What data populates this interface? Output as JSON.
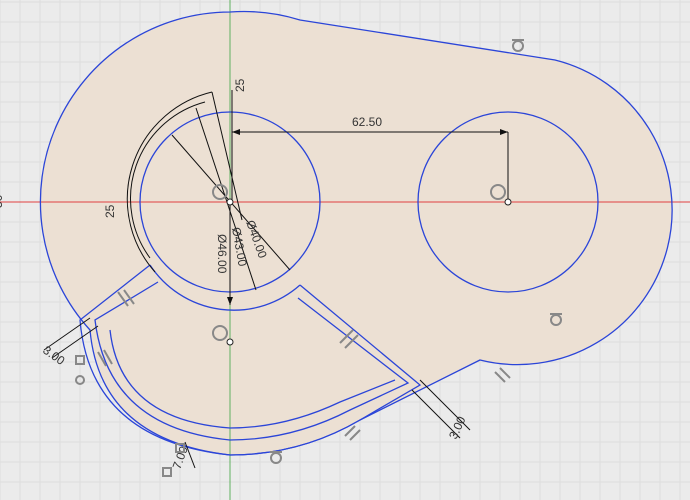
{
  "canvas": {
    "background": "#ebebeb",
    "profile_fill": "#ece0d3",
    "geometry_color": "#2b45d8",
    "dimension_color": "#111111",
    "x_axis_color": "#e04040",
    "y_axis_color": "#60b060",
    "constraint_icon_color": "#888888"
  },
  "dimensions": {
    "center_distance": "62.50",
    "dia_inner": "Ø40.00",
    "dia_middle": "Ø43.00",
    "dia_outer": "Ø46.00",
    "vert_offset": "25",
    "horiz_offset": "25",
    "offset_left": "3.00",
    "offset_right": "3.00",
    "bottom_dim": "7.00",
    "edge_label": "50"
  },
  "constraints": {
    "icons": [
      "tangent-icon",
      "parallel-icon",
      "coincident-icon",
      "concentric-icon",
      "fix-icon"
    ]
  }
}
